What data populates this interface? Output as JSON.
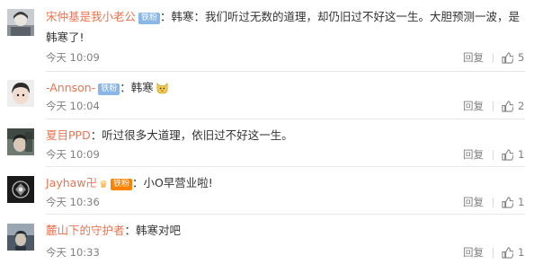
{
  "comments": [
    {
      "username": "宋仲基是我小老公",
      "badge": "铁粉",
      "text_line1": "：韩寒：我们听过无数的道理，却仍旧过不好这一生。大胆预测一波，是",
      "text_line2": "韩寒了!",
      "time": "今天 10:09",
      "reply_label": "回复",
      "likes": "5"
    },
    {
      "username": "-Annson-",
      "badge": "铁粉",
      "text_line1": "：韩寒",
      "time": "今天 10:04",
      "reply_label": "回复",
      "likes": "2"
    },
    {
      "username": "夏目PPD",
      "text_line1": "：听过很多大道理，依旧过不好这一生。",
      "time": "今天 10:09",
      "reply_label": "回复",
      "likes": "1"
    },
    {
      "username": "Jayhaw卍",
      "badge": "铁粉",
      "text_line1": "：小O早营业啦!",
      "time": "今天 10:36",
      "reply_label": "回复",
      "likes": "1"
    },
    {
      "username": "麓山下的守护者",
      "text_line1": "：韩寒对吧",
      "time": "今天 10:33",
      "reply_label": "回复",
      "likes": "1"
    }
  ],
  "colors": {
    "username": "#eb7350",
    "badge_blue": "#8ab7e6",
    "badge_orange": "#ff8200",
    "meta": "#808080"
  }
}
